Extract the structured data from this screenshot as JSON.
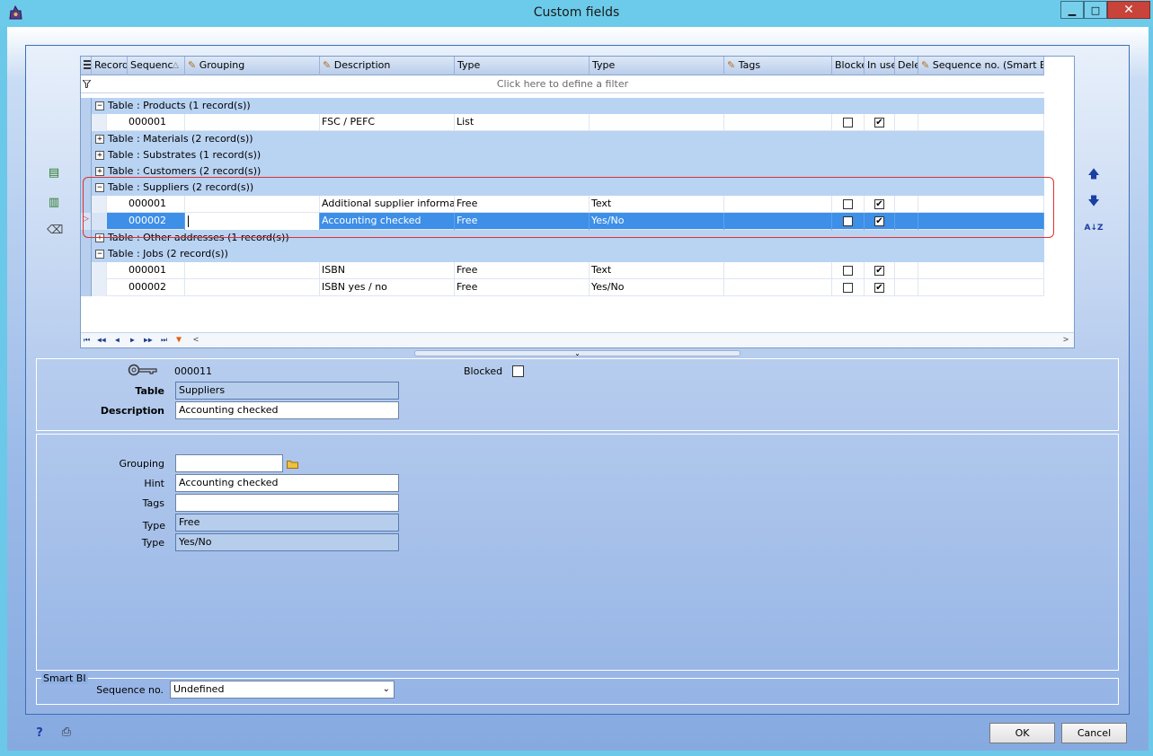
{
  "window": {
    "title": "Custom fields",
    "minimize": "▁",
    "maximize": "□",
    "close": "✕"
  },
  "grid": {
    "columns": [
      {
        "label": "Record",
        "left": 0
      },
      {
        "label": "Sequenc",
        "left": 0
      },
      {
        "label": "Grouping"
      },
      {
        "label": "Description"
      },
      {
        "label": "Type"
      },
      {
        "label": "Type"
      },
      {
        "label": "Tags"
      },
      {
        "label": "Blocke"
      },
      {
        "label": "In use"
      },
      {
        "label": "Dele"
      },
      {
        "label": "Sequence no. (Smart BI)"
      }
    ],
    "filter_placeholder": "Click here to define a filter",
    "groups": [
      {
        "label": "Table : Products (1 record(s))",
        "expander": "−"
      },
      {
        "label": "Table : Materials (2 record(s))",
        "expander": "+"
      },
      {
        "label": "Table : Substrates (1 record(s))",
        "expander": "+"
      },
      {
        "label": "Table : Customers (2 record(s))",
        "expander": "+"
      },
      {
        "label": "Table : Suppliers (2 record(s))",
        "expander": "−"
      },
      {
        "label": "Table : Other addresses (1 record(s))",
        "expander": "+"
      },
      {
        "label": "Table : Jobs (2 record(s))",
        "expander": "−"
      }
    ],
    "rows": [
      {
        "seq": "000001",
        "grouping": "",
        "description": "FSC / PEFC",
        "type1": "List",
        "type2": "",
        "tags": "",
        "blocked": "",
        "in_use": "✔"
      },
      {
        "seq": "000001",
        "grouping": "",
        "description": "Additional supplier information",
        "type1": "Free",
        "type2": "Text",
        "tags": "",
        "blocked": "",
        "in_use": "✔"
      },
      {
        "seq": "000002",
        "grouping": "",
        "description": "Accounting checked",
        "type1": "Free",
        "type2": "Yes/No",
        "tags": "",
        "blocked": "",
        "in_use": "✔"
      },
      {
        "seq": "000001",
        "grouping": "",
        "description": "ISBN",
        "type1": "Free",
        "type2": "Text",
        "tags": "",
        "blocked": "",
        "in_use": "✔"
      },
      {
        "seq": "000002",
        "grouping": "",
        "description": "ISBN yes / no",
        "type1": "Free",
        "type2": "Yes/No",
        "tags": "",
        "blocked": "",
        "in_use": "✔"
      }
    ],
    "nav": {
      "first": "⏮",
      "prev_page": "◀◀",
      "prev": "◀",
      "next": "▶",
      "next_page": "▶▶",
      "last": "⏭",
      "filter": "▼",
      "scroll_left": "<",
      "scroll_right": ">"
    }
  },
  "side_tools": {
    "up": "🡅",
    "down": "🡇",
    "sort": "A↓Z"
  },
  "detail": {
    "record_id": "000011",
    "blocked_label": "Blocked",
    "table_label": "Table",
    "table_value": "Suppliers",
    "description_label": "Description",
    "description_value": "Accounting checked",
    "grouping_label": "Grouping",
    "grouping_value": "",
    "hint_label": "Hint",
    "hint_value": "Accounting checked",
    "tags_label": "Tags",
    "tags_value": "",
    "type1_label": "Type",
    "type1_value": "Free",
    "type2_label": "Type",
    "type2_value": "Yes/No"
  },
  "smart_bi": {
    "legend": "Smart BI",
    "sequence_label": "Sequence no.",
    "sequence_value": "Undefined"
  },
  "footer": {
    "ok": "OK",
    "cancel": "Cancel"
  }
}
